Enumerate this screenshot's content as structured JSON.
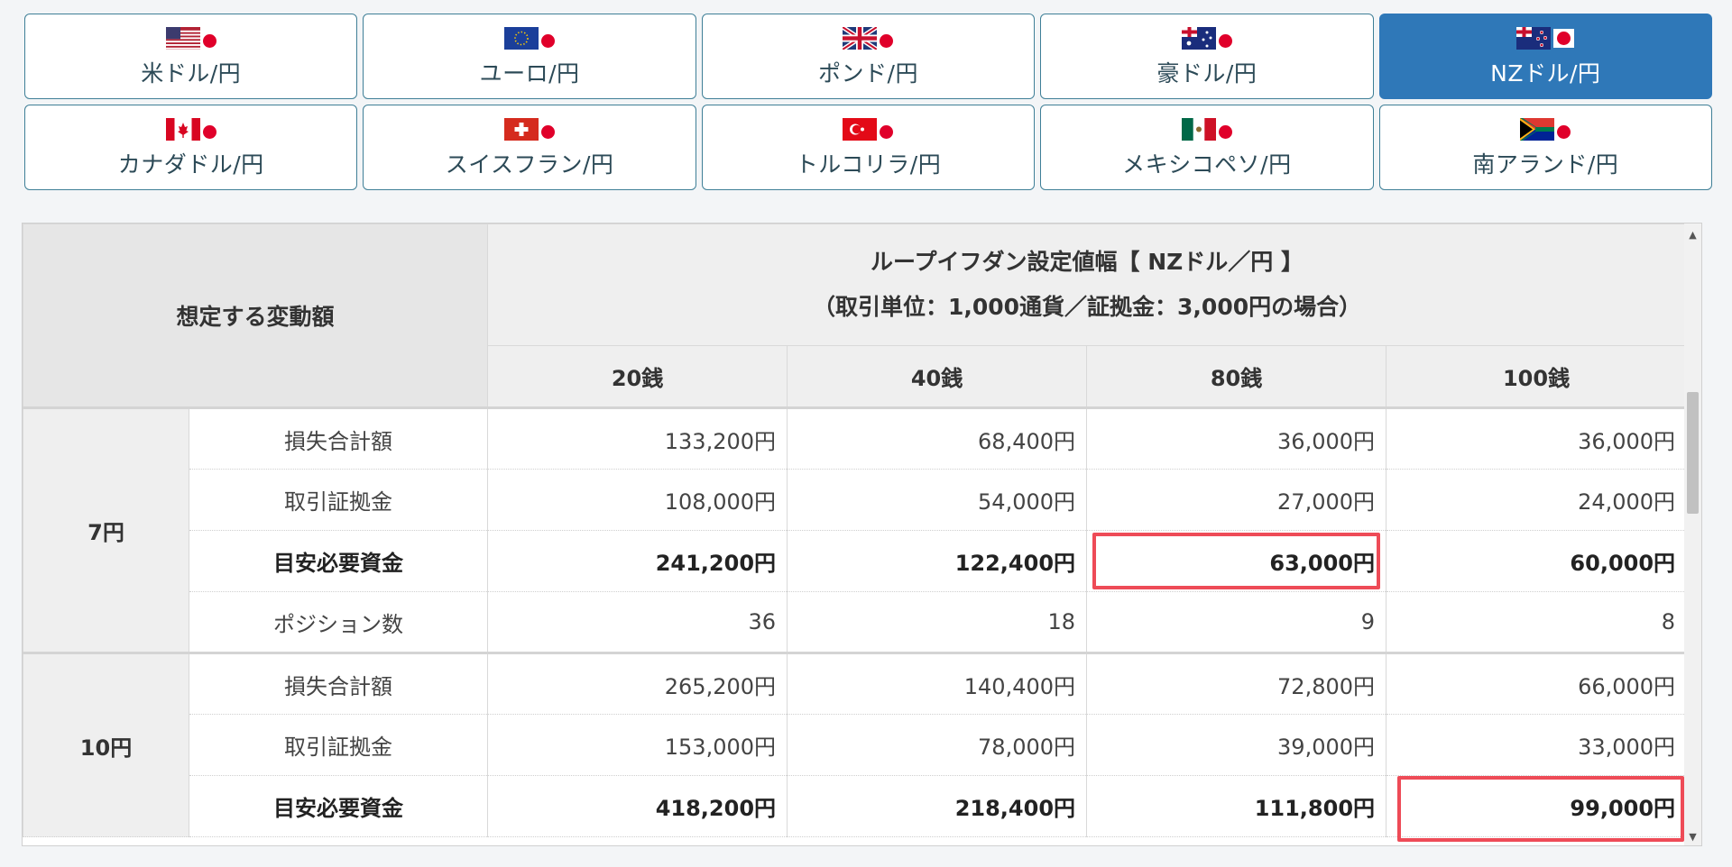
{
  "tabs": [
    {
      "label": "米ドル/円",
      "flag": "us-flag-icon",
      "active": false
    },
    {
      "label": "ユーロ/円",
      "flag": "eu-flag-icon",
      "active": false
    },
    {
      "label": "ポンド/円",
      "flag": "uk-flag-icon",
      "active": false
    },
    {
      "label": "豪ドル/円",
      "flag": "au-flag-icon",
      "active": false
    },
    {
      "label": "NZドル/円",
      "flag": "nz-flag-icon",
      "active": true
    },
    {
      "label": "カナダドル/円",
      "flag": "ca-flag-icon",
      "active": false
    },
    {
      "label": "スイスフラン/円",
      "flag": "ch-flag-icon",
      "active": false
    },
    {
      "label": "トルコリラ/円",
      "flag": "tr-flag-icon",
      "active": false
    },
    {
      "label": "メキシコペソ/円",
      "flag": "mx-flag-icon",
      "active": false
    },
    {
      "label": "南アランド/円",
      "flag": "za-flag-icon",
      "active": false
    }
  ],
  "table": {
    "left_header": "想定する変動額",
    "title_line1": "ループイフダン設定値幅【 NZドル／円 】",
    "title_line2": "（取引単位：1,000通貨／証拠金：3,000円の場合）",
    "columns": [
      "20銭",
      "40銭",
      "80銭",
      "100銭"
    ],
    "groups": [
      {
        "label": "7円",
        "rows": [
          {
            "label": "損失合計額",
            "values": [
              "133,200円",
              "68,400円",
              "36,000円",
              "36,000円"
            ]
          },
          {
            "label": "取引証拠金",
            "values": [
              "108,000円",
              "54,000円",
              "27,000円",
              "24,000円"
            ]
          },
          {
            "label": "目安必要資金",
            "values": [
              "241,200円",
              "122,400円",
              "63,000円",
              "60,000円"
            ]
          },
          {
            "label": "ポジション数",
            "values": [
              "36",
              "18",
              "9",
              "8"
            ]
          }
        ]
      },
      {
        "label": "10円",
        "rows": [
          {
            "label": "損失合計額",
            "values": [
              "265,200円",
              "140,400円",
              "72,800円",
              "66,000円"
            ]
          },
          {
            "label": "取引証拠金",
            "values": [
              "153,000円",
              "78,000円",
              "39,000円",
              "33,000円"
            ]
          },
          {
            "label": "目安必要資金",
            "values": [
              "418,200円",
              "218,400円",
              "111,800円",
              "99,000円"
            ]
          }
        ]
      }
    ]
  },
  "colors": {
    "active_tab": "#2f78b8",
    "tab_border": "#3f7f97",
    "highlight_box": "#ee4b57",
    "japan_red": "#e0002a"
  }
}
